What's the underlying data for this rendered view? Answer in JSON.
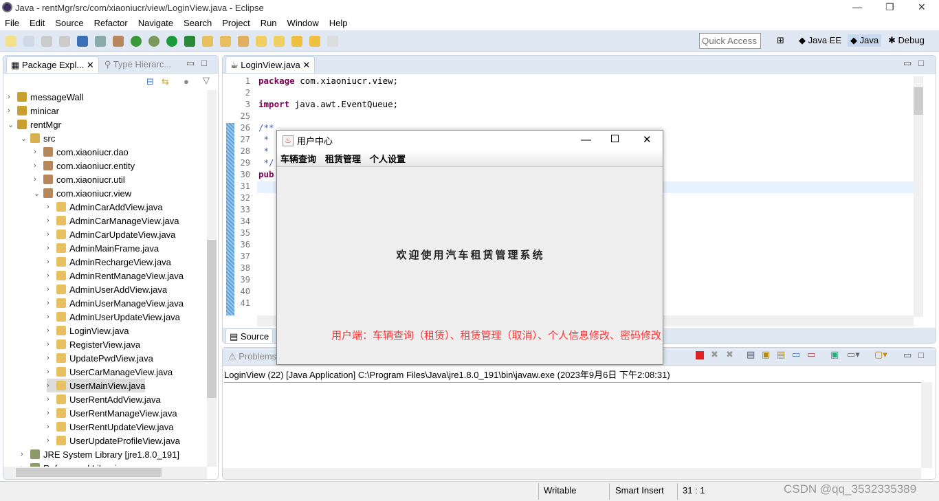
{
  "window": {
    "title": "Java - rentMgr/src/com/xiaoniucr/view/LoginView.java - Eclipse",
    "minimize": "—",
    "restore": "❐",
    "close": "✕"
  },
  "menu": [
    "File",
    "Edit",
    "Source",
    "Refactor",
    "Navigate",
    "Search",
    "Project",
    "Run",
    "Window",
    "Help"
  ],
  "toolbar": {
    "quick_access_placeholder": "Quick Access",
    "perspectives": [
      "Java EE",
      "Java",
      "Debug"
    ]
  },
  "explorer": {
    "tabs": [
      "Package Expl...",
      "Type Hierarc..."
    ],
    "items": [
      {
        "label": "messageWall",
        "level": 0,
        "open": false,
        "type": "project"
      },
      {
        "label": "minicar",
        "level": 0,
        "open": false,
        "type": "project"
      },
      {
        "label": "rentMgr",
        "level": 0,
        "open": true,
        "type": "project"
      },
      {
        "label": "src",
        "level": 1,
        "open": true,
        "type": "folder"
      },
      {
        "label": "com.xiaoniucr.dao",
        "level": 2,
        "open": false,
        "type": "package"
      },
      {
        "label": "com.xiaoniucr.entity",
        "level": 2,
        "open": false,
        "type": "package"
      },
      {
        "label": "com.xiaoniucr.util",
        "level": 2,
        "open": false,
        "type": "package"
      },
      {
        "label": "com.xiaoniucr.view",
        "level": 2,
        "open": true,
        "type": "package"
      },
      {
        "label": "AdminCarAddView.java",
        "level": 3,
        "type": "java"
      },
      {
        "label": "AdminCarManageView.java",
        "level": 3,
        "type": "java"
      },
      {
        "label": "AdminCarUpdateView.java",
        "level": 3,
        "type": "java"
      },
      {
        "label": "AdminMainFrame.java",
        "level": 3,
        "type": "java"
      },
      {
        "label": "AdminRechargeView.java",
        "level": 3,
        "type": "java"
      },
      {
        "label": "AdminRentManageView.java",
        "level": 3,
        "type": "java"
      },
      {
        "label": "AdminUserAddView.java",
        "level": 3,
        "type": "java"
      },
      {
        "label": "AdminUserManageView.java",
        "level": 3,
        "type": "java"
      },
      {
        "label": "AdminUserUpdateView.java",
        "level": 3,
        "type": "java"
      },
      {
        "label": "LoginView.java",
        "level": 3,
        "type": "java"
      },
      {
        "label": "RegisterView.java",
        "level": 3,
        "type": "java"
      },
      {
        "label": "UpdatePwdView.java",
        "level": 3,
        "type": "java"
      },
      {
        "label": "UserCarManageView.java",
        "level": 3,
        "type": "java"
      },
      {
        "label": "UserMainView.java",
        "level": 3,
        "type": "java",
        "selected": true
      },
      {
        "label": "UserRentAddView.java",
        "level": 3,
        "type": "java"
      },
      {
        "label": "UserRentManageView.java",
        "level": 3,
        "type": "java"
      },
      {
        "label": "UserRentUpdateView.java",
        "level": 3,
        "type": "java"
      },
      {
        "label": "UserUpdateProfileView.java",
        "level": 3,
        "type": "java"
      },
      {
        "label": "JRE System Library [jre1.8.0_191]",
        "level": 1,
        "open": false,
        "type": "lib"
      },
      {
        "label": "Referenced Libraries",
        "level": 1,
        "open": false,
        "type": "lib"
      }
    ]
  },
  "editor": {
    "tab": "LoginView.java",
    "bottom_tab": "Source",
    "lines": [
      {
        "n": "1",
        "kw": "package",
        "text": " com.xiaoniucr.view;"
      },
      {
        "n": "2",
        "kw": "",
        "text": ""
      },
      {
        "n": "3",
        "kw": "import",
        "text": " java.awt.EventQueue;"
      },
      {
        "n": "25",
        "kw": "",
        "text": ""
      },
      {
        "n": "26",
        "kw": "",
        "text": "/**"
      },
      {
        "n": "27",
        "kw": "",
        "text": " *"
      },
      {
        "n": "28",
        "kw": "",
        "text": " *"
      },
      {
        "n": "29",
        "kw": "",
        "text": " */"
      },
      {
        "n": "30",
        "kw": "pub",
        "text": ""
      },
      {
        "n": "31",
        "kw": "",
        "text": ""
      },
      {
        "n": "32",
        "kw": "",
        "text": ""
      },
      {
        "n": "33",
        "kw": "",
        "text": ""
      },
      {
        "n": "34",
        "kw": "",
        "text": ""
      },
      {
        "n": "35",
        "kw": "",
        "text": ""
      },
      {
        "n": "36",
        "kw": "",
        "text": ""
      },
      {
        "n": "37",
        "kw": "",
        "text": ""
      },
      {
        "n": "38",
        "kw": "",
        "text": ""
      },
      {
        "n": "39",
        "kw": "",
        "text": ""
      },
      {
        "n": "40",
        "kw": "",
        "text": ""
      },
      {
        "n": "41",
        "kw": "",
        "text": ""
      }
    ]
  },
  "console": {
    "tab": "Problems",
    "launch": "LoginView (22) [Java Application] C:\\Program Files\\Java\\jre1.8.0_191\\bin\\javaw.exe (2023年9月6日 下午2:08:31)"
  },
  "dialog": {
    "title": "用户中心",
    "menu": [
      "车辆查询",
      "租赁管理",
      "个人设置"
    ],
    "welcome": "欢迎使用汽车租赁管理系统"
  },
  "annotation": {
    "text": "用户端：车辆查询（租赁）、租赁管理（取消）、个人信息修改、密码修改",
    "color": "#ff3333"
  },
  "status": {
    "writable": "Writable",
    "insert": "Smart Insert",
    "position": "31 : 1",
    "watermark": "CSDN @qq_3532335389"
  }
}
